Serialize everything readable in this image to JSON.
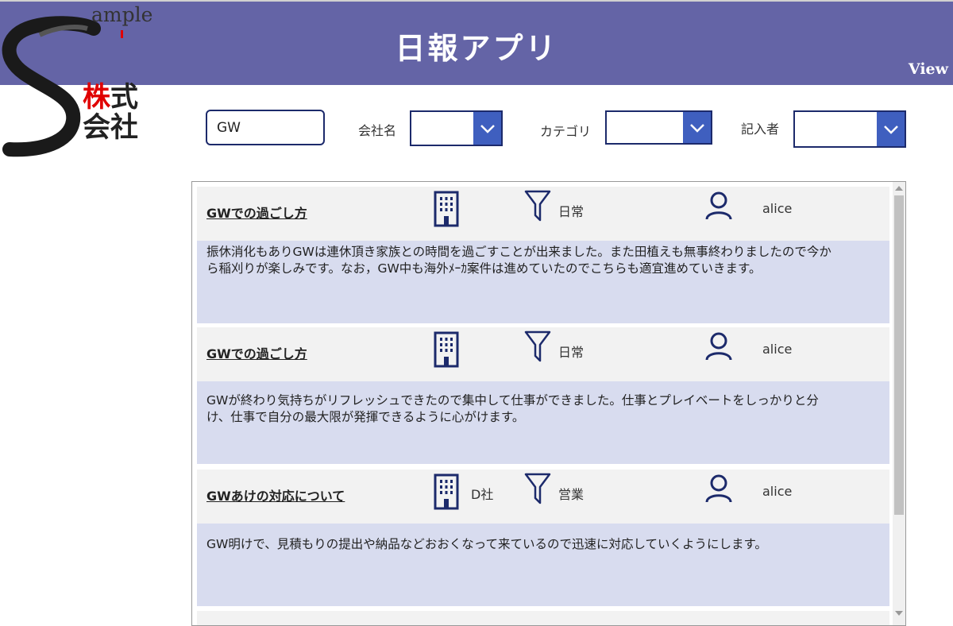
{
  "header": {
    "title": "日報アプリ",
    "view_label": "View",
    "color": "#6464a6"
  },
  "logo": {
    "sample_text": "ample",
    "company_line1_red": "株",
    "company_line1_black": "式",
    "company_line2": "会社"
  },
  "filters": {
    "search_value": "GW",
    "company_label": "会社名",
    "category_label": "カテゴリ",
    "author_label": "記入者",
    "dropdown_accent": "#3f5fbf"
  },
  "reports": [
    {
      "title": "GWでの過ごし方",
      "company": "",
      "category": "日常",
      "author": "alice",
      "body": "振休消化もありGWは連休頂き家族との時間を過ごすことが出来ました。また田植えも無事終わりましたので今から稲刈りが楽しみです。なお，GW中も海外ﾒｰｶ案件は進めていたのでこちらも適宜進めていきます。"
    },
    {
      "title": "GWでの過ごし方",
      "company": "",
      "category": "日常",
      "author": "alice",
      "body": "GWが終わり気持ちがリフレッシュできたので集中して仕事ができました。仕事とプレイベートをしっかりと分け、仕事で自分の最大限が発揮できるように心がけます。"
    },
    {
      "title": "GWあけの対応について",
      "company": "D社",
      "category": "営業",
      "author": "alice",
      "body": "GW明けで、見積もりの提出や納品などおおくなって来ているので迅速に対応していくようにします。"
    }
  ],
  "icons": {
    "company": "building-icon",
    "category": "filter-icon",
    "author": "person-icon",
    "icon_color": "#1c2a6b"
  }
}
